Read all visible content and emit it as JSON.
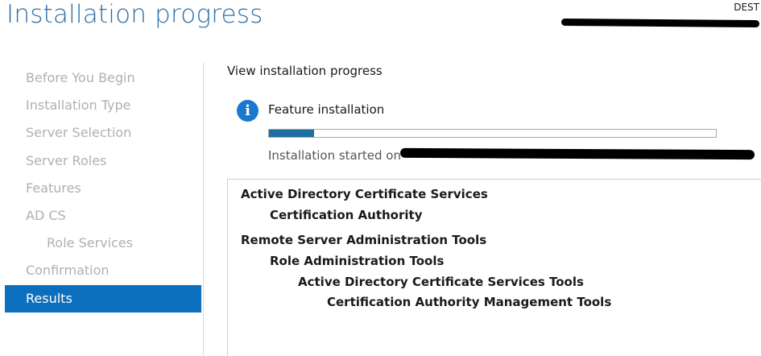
{
  "header": {
    "title": "Installation progress",
    "destination_label": "DEST"
  },
  "nav": {
    "items": [
      {
        "label": "Before You Begin"
      },
      {
        "label": "Installation Type"
      },
      {
        "label": "Server Selection"
      },
      {
        "label": "Server Roles"
      },
      {
        "label": "Features"
      },
      {
        "label": "AD CS"
      },
      {
        "label": "Role Services"
      },
      {
        "label": "Confirmation"
      },
      {
        "label": "Results"
      }
    ],
    "active": "Results"
  },
  "main": {
    "section_heading": "View installation progress",
    "status": {
      "icon": "info-icon",
      "label": "Feature installation",
      "progress_fraction": 0.1,
      "started_text": "Installation started on"
    },
    "features": [
      {
        "label": "Active Directory Certificate Services",
        "level": 0
      },
      {
        "label": "Certification Authority",
        "level": 1
      },
      {
        "label": "Remote Server Administration Tools",
        "level": 0
      },
      {
        "label": "Role Administration Tools",
        "level": 1
      },
      {
        "label": "Active Directory Certificate Services Tools",
        "level": 2
      },
      {
        "label": "Certification Authority Management Tools",
        "level": 3
      }
    ]
  },
  "colors": {
    "title": "#2f6fa6",
    "nav_active_bg": "#0c6fbd",
    "progress_fill": "#1c6f9e",
    "info_icon": "#1b78cf"
  }
}
